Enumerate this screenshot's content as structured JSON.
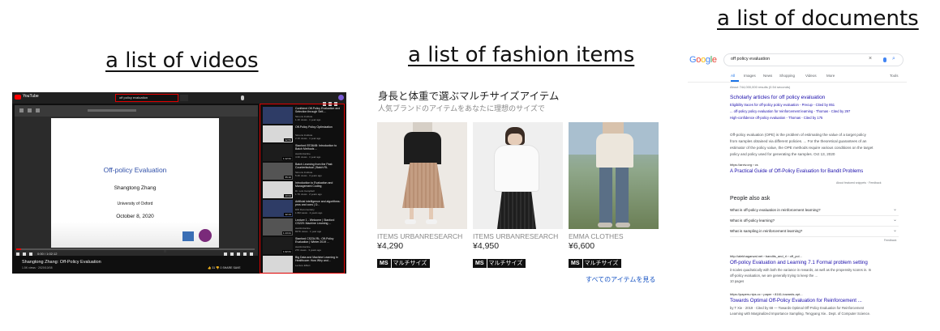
{
  "headings": {
    "videos": "a list of videos",
    "fashion": "a list of fashion items",
    "documents": "a list of documents"
  },
  "youtube": {
    "logo": "YouTube",
    "search_query": "off policy evaluation",
    "slide": {
      "title": "Off-policy Evaluation",
      "author": "Shangtong Zhang",
      "institution": "University of Oxford",
      "date": "October 8, 2020"
    },
    "progress": 0.02,
    "time": "0:00 / 1:02:12",
    "video_title": "Shangtong Zhang: Off-Policy Evaluation",
    "video_meta": "1.5K views · 2020/10/08",
    "actions": "👍 31  👎 0  SHARE  SAVE",
    "recommendations": [
      {
        "title": "Confident Off-Policy Evaluation and Selection through Self-...",
        "channel": "Simons Institute",
        "views": "1.1K views · 1 year ago",
        "duration": "",
        "tone": "blue"
      },
      {
        "title": "Off-Policy Policy Optimization",
        "channel": "Simons Institute",
        "views": "2.1K views · 1 year ago",
        "duration": "32:53",
        "tone": "light"
      },
      {
        "title": "Stanford EE364B: Introduction to Batch Methods ...",
        "channel": "stanfordonline",
        "views": "4.3K views · 1 year ago",
        "duration": "1:12:31",
        "tone": "dark"
      },
      {
        "title": "Batch Learning from the Past: Counterfactual | Batch RL",
        "channel": "Simons Institute",
        "views": "5.4K views · 3 years ago",
        "duration": "55:10",
        "tone": "grey"
      },
      {
        "title": "Introduction to Evaluation and Management Coding",
        "channel": "Dr. Lois Campbell",
        "views": "1.7K views · 2 years ago",
        "duration": "20:02",
        "tone": "light"
      },
      {
        "title": "Artificial intelligence and algorithms: pros and cons | D...",
        "channel": "DW Documentary",
        "views": "1.9M views · 2 years ago",
        "duration": "42:13",
        "tone": "blue"
      },
      {
        "title": "Lecture 1 - Welcome | Stanford CS229: Machine Learning ...",
        "channel": "stanfordonline",
        "views": "837K views · 1 year ago",
        "duration": "1:13:21",
        "tone": "grey"
      },
      {
        "title": "Stanford CS234 RL: Off-Policy Evaluation | Winter 2019 ...",
        "channel": "stanfordonline",
        "views": "27K views · 3 years ago",
        "duration": "1:22:41",
        "tone": "dark"
      },
      {
        "title": "Big Data and Machine Learning in Healthcare: How Why and...",
        "channel": "Lecture Effect",
        "views": "",
        "duration": "",
        "tone": "light"
      }
    ]
  },
  "fashion": {
    "title": "身長と体重で選ぶマルチサイズアイテム",
    "subtitle": "人気ブランドのアイテムをあなたに理想のサイズで",
    "items": [
      {
        "brand": "ITEMS URBANRESEARCH",
        "price": "¥4,290",
        "badge_code": "MS",
        "badge_label": "マルチサイズ"
      },
      {
        "brand": "ITEMS URBANRESEARCH",
        "price": "¥4,950",
        "badge_code": "MS",
        "badge_label": "マルチサイズ"
      },
      {
        "brand": "EMMA CLOTHES",
        "price": "¥6,600",
        "badge_code": "MS",
        "badge_label": "マルチサイズ"
      }
    ],
    "see_all": "すべてのアイテムを見る"
  },
  "google": {
    "query": "off policy evaluation",
    "tabs": [
      "All",
      "Images",
      "News",
      "Shopping",
      "Videos",
      "More",
      "Tools"
    ],
    "stats": "About 744,000,000 results (0.54 seconds)",
    "scholarly": {
      "heading": "Scholarly articles for off policy evaluation",
      "lines": [
        "Eligibility traces for off-policy policy evaluation - Precup - Cited by 851",
        "... off-policy policy evaluation for reinforcement learning - Thomas - Cited by 297",
        "High-confidence off-policy evaluation - Thomas - Cited by 175"
      ]
    },
    "snippet_lines": [
      "Off-policy evaluation (OPE) is the problem of estimating the value of a target policy",
      "from samples obtained via different policies. ... For the theoretical guarantees of an",
      "estimator of the policy value, the OPE methods require various conditions on the target",
      "policy and policy used for generating the samples. Oct 13, 2020"
    ],
    "snippet_url": "https://arxiv.org › cs",
    "snippet_link": "A Practical Guide of Off-Policy Evaluation for Bandit Problems",
    "about_snippets": "About featured snippets · Feedback",
    "paa_title": "People also ask",
    "paa": [
      "What is off-policy evaluation in reinforcement learning?",
      "What is off-policy learning?",
      "What is sampling in reinforcement learning?"
    ],
    "feedback": "Feedback",
    "results": [
      {
        "url": "http://alekhagarwal.net › bandits_and_rl › off_pol...",
        "title": "Off-policy Evaluation and Learning 7.1 Formal problem setting",
        "lines": [
          "it scales quadratically with both the variance in rewards, as well as the propensity scores in. In",
          "off-policy evaluation, we are generally trying to keep the ...",
          "10 pages"
        ]
      },
      {
        "url": "https://papers.nips.cc › paper › 8161-towards-opt...",
        "title": "Towards Optimal Off-Policy Evaluation for Reinforcement ...",
        "lines": [
          "by T Xie · 2019 · Cited by 68 — Towards Optimal Off-Policy Evaluation for Reinforcement",
          "Learning with Marginalized Importance Sampling. Tengyang Xie.. Dept. of Computer Science."
        ]
      }
    ]
  }
}
